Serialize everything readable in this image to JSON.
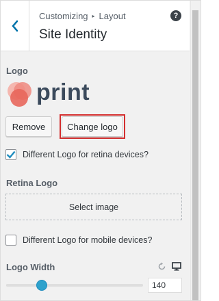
{
  "header": {
    "breadcrumb_root": "Customizing",
    "breadcrumb_separator": "▸",
    "breadcrumb_current": "Layout",
    "title": "Site Identity",
    "help_icon": "?"
  },
  "logo_section": {
    "label": "Logo",
    "logo_text": "print",
    "remove_label": "Remove",
    "change_label": "Change logo"
  },
  "retina": {
    "checkbox_label": "Different Logo for retina devices?",
    "checked": true,
    "label": "Retina Logo",
    "select_label": "Select image"
  },
  "mobile": {
    "checkbox_label": "Different Logo for mobile devices?",
    "checked": false
  },
  "logo_width": {
    "label": "Logo Width",
    "value": "140",
    "slider_fraction": 0.26
  },
  "colors": {
    "accent": "#2ea2cc",
    "highlight": "#d32f2f",
    "logo_circle_1": "#f2a7a0",
    "logo_circle_2": "#ea6b60",
    "logo_text": "#3b4a5c"
  }
}
